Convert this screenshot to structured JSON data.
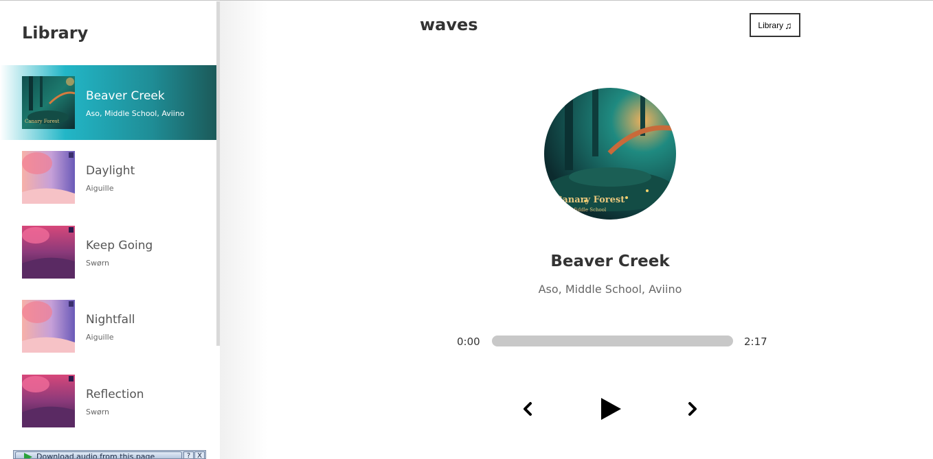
{
  "app": {
    "title": "waves"
  },
  "header": {
    "library_label": "Library",
    "library_icon": "music-note-icon"
  },
  "sidebar": {
    "title": "Library",
    "songs": [
      {
        "title": "Beaver Creek",
        "artist": "Aso, Middle School, Aviino",
        "active": true,
        "cover_text": "Canary Forest"
      },
      {
        "title": "Daylight",
        "artist": "Aiguille",
        "active": false
      },
      {
        "title": "Keep Going",
        "artist": "Swørn",
        "active": false
      },
      {
        "title": "Nightfall",
        "artist": "Aiguille",
        "active": false
      },
      {
        "title": "Reflection",
        "artist": "Swørn",
        "active": false
      }
    ]
  },
  "player": {
    "title": "Beaver Creek",
    "artist": "Aso, Middle School, Aviino",
    "cover_text": "Canary Forest",
    "cover_subtext": "Aso, Middle School",
    "current_time": "0:00",
    "total_time": "2:17",
    "progress": 0,
    "controls": {
      "prev_icon": "chevron-left-icon",
      "play_icon": "play-icon",
      "next_icon": "chevron-right-icon"
    }
  },
  "download_bar": {
    "label": "Download audio from this page",
    "help": "?",
    "close": "X"
  },
  "colors": {
    "active_start": "#22b6c7",
    "active_end": "#1b5958",
    "text_dark": "#333333",
    "track": "#c8c8c8"
  }
}
